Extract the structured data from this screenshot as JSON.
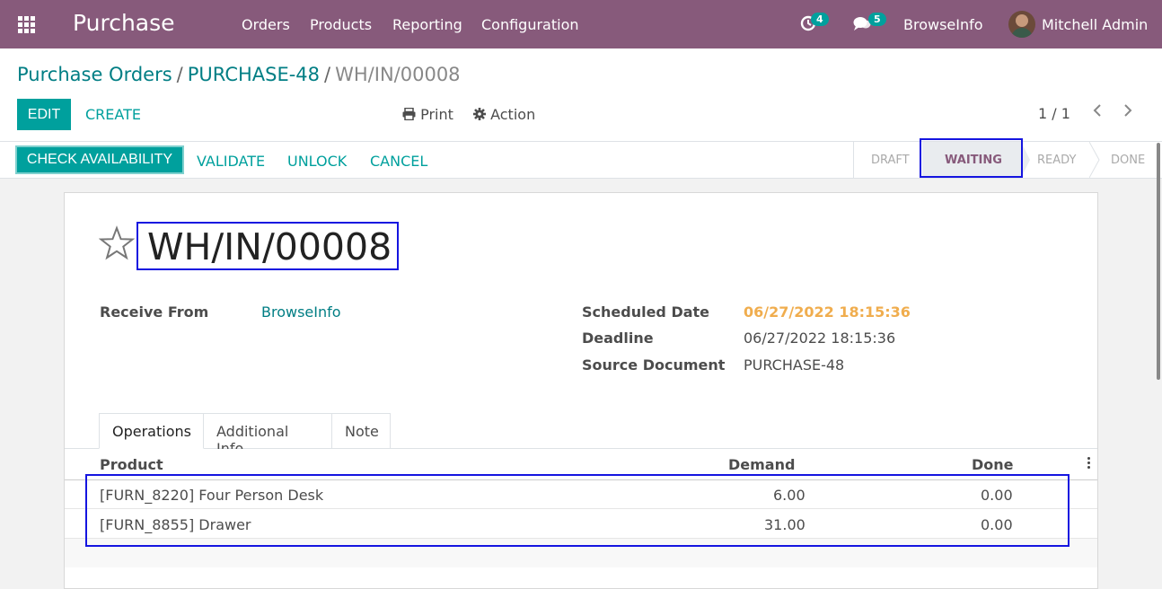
{
  "navbar": {
    "app_title": "Purchase",
    "menu": [
      "Orders",
      "Products",
      "Reporting",
      "Configuration"
    ],
    "activity_count": "4",
    "message_count": "5",
    "company": "BrowseInfo",
    "user": "Mitchell Admin"
  },
  "breadcrumb": {
    "items": [
      "Purchase Orders",
      "PURCHASE-48",
      "WH/IN/00008"
    ],
    "separator": "/"
  },
  "toolbar": {
    "edit_label": "EDIT",
    "create_label": "CREATE",
    "print_label": "Print",
    "action_label": "Action",
    "pager": "1 / 1"
  },
  "statusbar": {
    "buttons": [
      "CHECK AVAILABILITY",
      "VALIDATE",
      "UNLOCK",
      "CANCEL"
    ],
    "stages": [
      "DRAFT",
      "WAITING",
      "READY",
      "DONE"
    ],
    "active_stage": "WAITING"
  },
  "record": {
    "name": "WH/IN/00008",
    "receive_from_label": "Receive From",
    "receive_from": "BrowseInfo",
    "scheduled_date_label": "Scheduled Date",
    "scheduled_date": "06/27/2022 18:15:36",
    "deadline_label": "Deadline",
    "deadline": "06/27/2022 18:15:36",
    "source_document_label": "Source Document",
    "source_document": "PURCHASE-48"
  },
  "tabs": [
    "Operations",
    "Additional Info",
    "Note"
  ],
  "table": {
    "columns": [
      "Product",
      "Demand",
      "Done"
    ],
    "rows": [
      {
        "product": "[FURN_8220] Four Person Desk",
        "demand": "6.00",
        "done": "0.00"
      },
      {
        "product": "[FURN_8855] Drawer",
        "demand": "31.00",
        "done": "0.00"
      }
    ]
  },
  "colors": {
    "navbar": "#875a7b",
    "primary": "#00a09d",
    "link": "#017e84",
    "warning": "#f0ad4e",
    "highlight": "#1515e0"
  }
}
